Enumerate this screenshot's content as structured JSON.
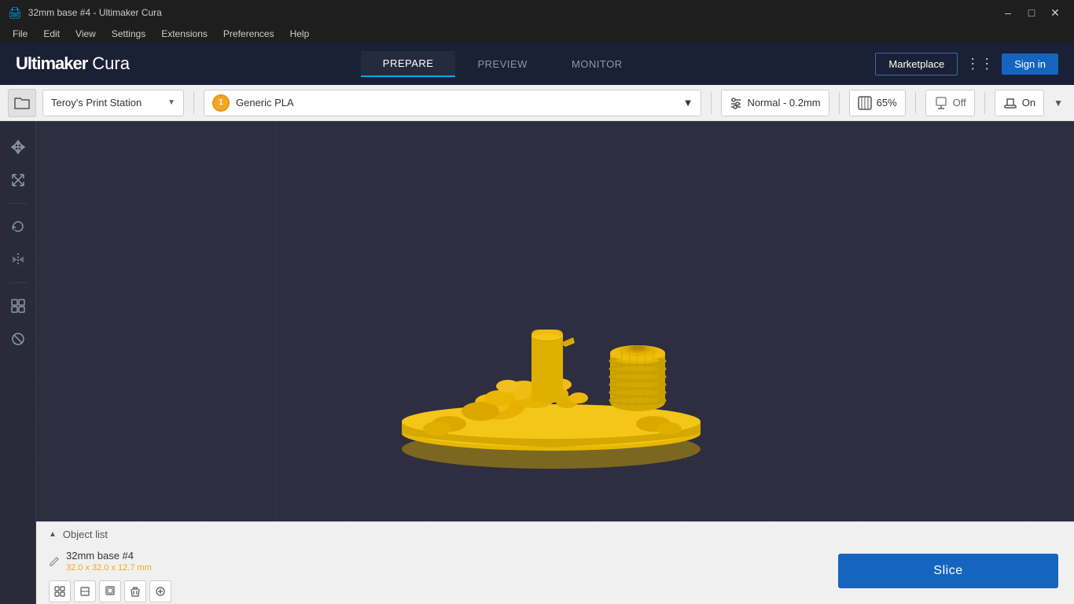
{
  "window": {
    "title": "32mm base #4 - Ultimaker Cura",
    "logo_icon": "🖨"
  },
  "menu": {
    "items": [
      "File",
      "Edit",
      "View",
      "Settings",
      "Extensions",
      "Preferences",
      "Help"
    ]
  },
  "nav": {
    "logo_bold": "Ultimaker",
    "logo_light": "Cura",
    "tabs": [
      {
        "id": "prepare",
        "label": "PREPARE",
        "active": true
      },
      {
        "id": "preview",
        "label": "PREVIEW",
        "active": false
      },
      {
        "id": "monitor",
        "label": "MONITOR",
        "active": false
      }
    ],
    "marketplace_label": "Marketplace",
    "signin_label": "Sign in"
  },
  "toolbar": {
    "printer": "Teroy's Print Station",
    "material_number": "1",
    "material_name": "Generic PLA",
    "profile": "Normal - 0.2mm",
    "infill_percent": "65%",
    "support_label": "Off",
    "adhesion_label": "On"
  },
  "tools": {
    "items": [
      {
        "id": "move",
        "icon": "✛",
        "label": "Move"
      },
      {
        "id": "scale",
        "icon": "⤢",
        "label": "Scale"
      },
      {
        "id": "rotate",
        "icon": "↺",
        "label": "Rotate"
      },
      {
        "id": "mirror",
        "icon": "⇔",
        "label": "Mirror"
      },
      {
        "id": "permodel",
        "icon": "⊞",
        "label": "Per Model Settings"
      },
      {
        "id": "support",
        "icon": "⚙",
        "label": "Support Blocker"
      }
    ]
  },
  "object_list": {
    "header": "Object list",
    "objects": [
      {
        "name": "32mm base #4",
        "dimensions": "32.0 x 32.0 x 12.7 mm"
      }
    ]
  },
  "actions": {
    "slice_label": "Slice"
  },
  "colors": {
    "background": "#2e2e40",
    "grid_line": "#3a3a50",
    "model_fill": "#f5c518",
    "model_shadow": "#c8a000",
    "nav_bg": "#1a2035",
    "toolbar_bg": "#f0f0f0",
    "accent_blue": "#1565c0"
  }
}
